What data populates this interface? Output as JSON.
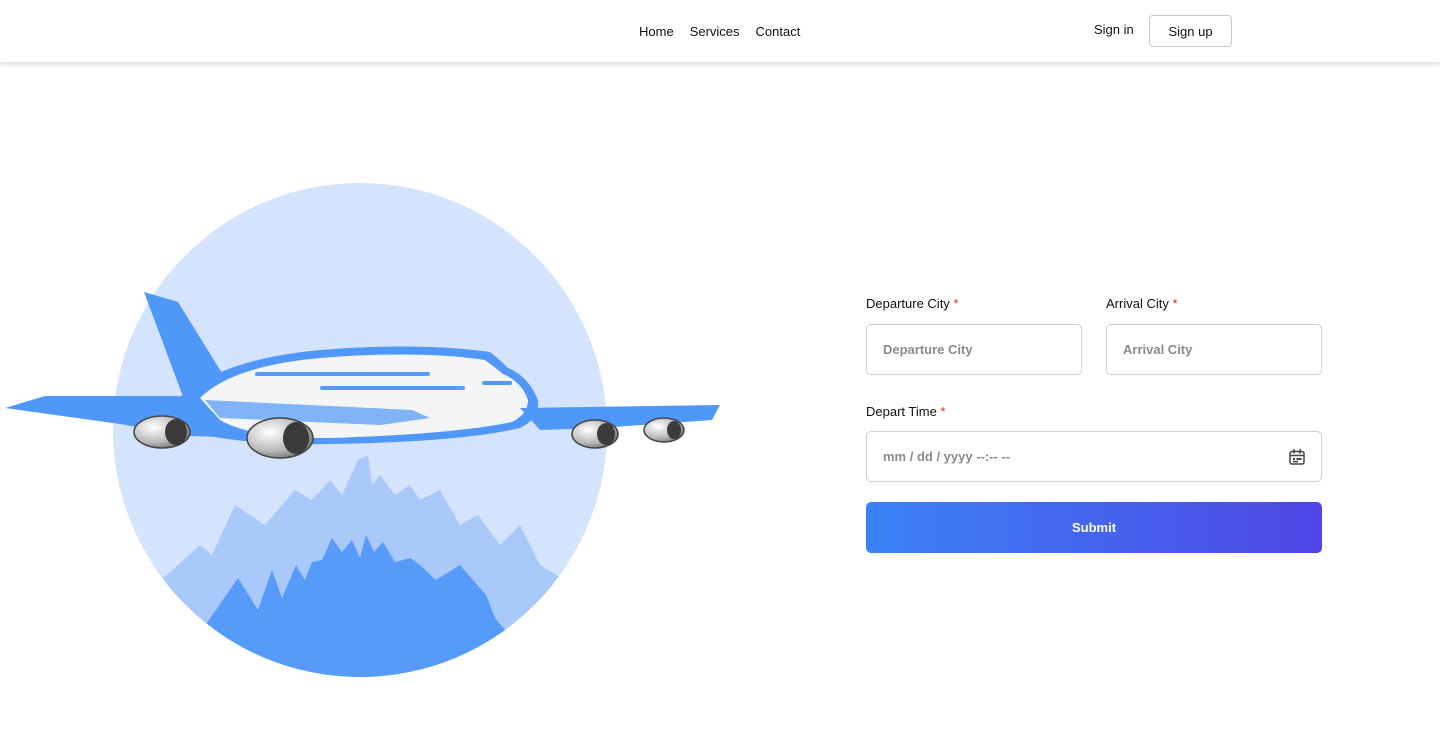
{
  "nav": {
    "links": [
      {
        "label": "Home"
      },
      {
        "label": "Services"
      },
      {
        "label": "Contact"
      }
    ],
    "signin_label": "Sign in",
    "signup_label": "Sign up"
  },
  "illustration": {
    "icon": "airplane-over-mountains-icon",
    "colors": {
      "sky": "#d4e4fd",
      "far_mountains": "#a9c9fb",
      "near_mountains": "#569bfa",
      "plane_accent": "#4f97f8",
      "plane_body": "#f4f5f6"
    }
  },
  "form": {
    "departure": {
      "label": "Departure City",
      "required_mark": "*",
      "placeholder": "Departure City"
    },
    "arrival": {
      "label": "Arrival City",
      "required_mark": "*",
      "placeholder": "Arrival City"
    },
    "depart_time": {
      "label": "Depart Time",
      "required_mark": "*",
      "placeholder": "mm / dd / yyyy --:-- --",
      "icon": "calendar-icon"
    },
    "submit_label": "Submit",
    "colors": {
      "gradient_start": "#3b82f6",
      "gradient_end": "#4f46e5",
      "required": "#e02424"
    }
  }
}
